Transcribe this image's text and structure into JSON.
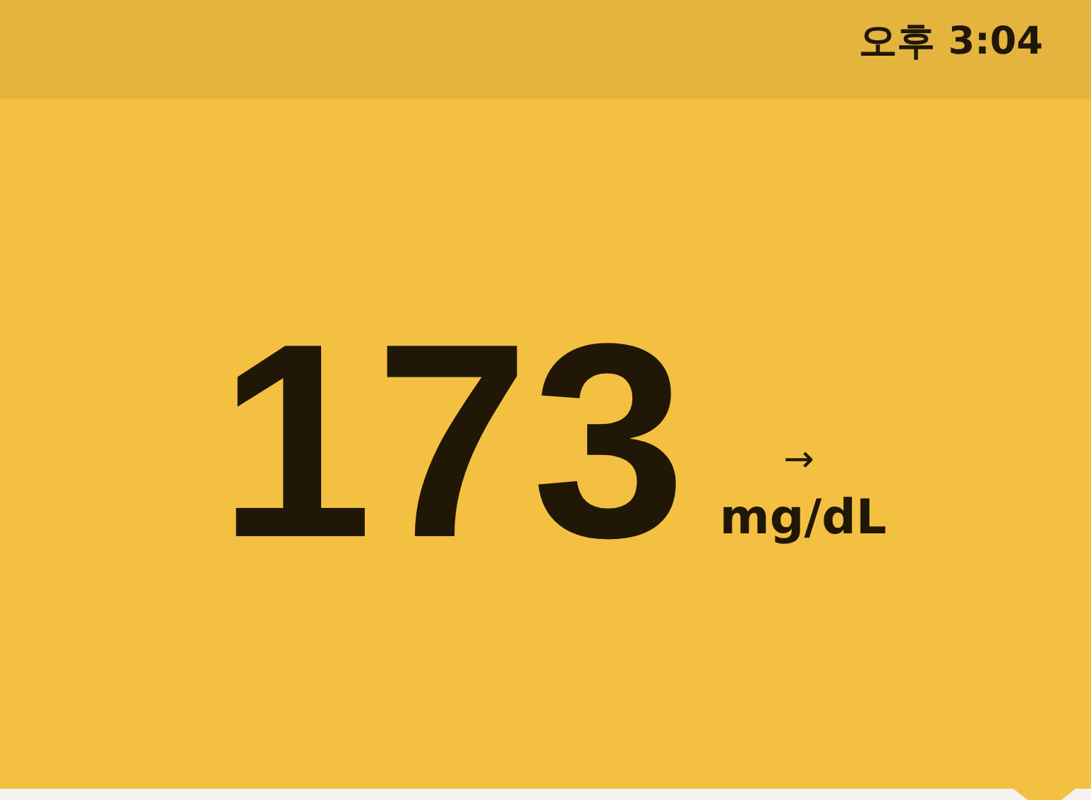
{
  "status_bar": {
    "time": "오후 3:04"
  },
  "reading": {
    "value": "173",
    "trend_arrow": "→",
    "unit": "mg/dL"
  }
}
